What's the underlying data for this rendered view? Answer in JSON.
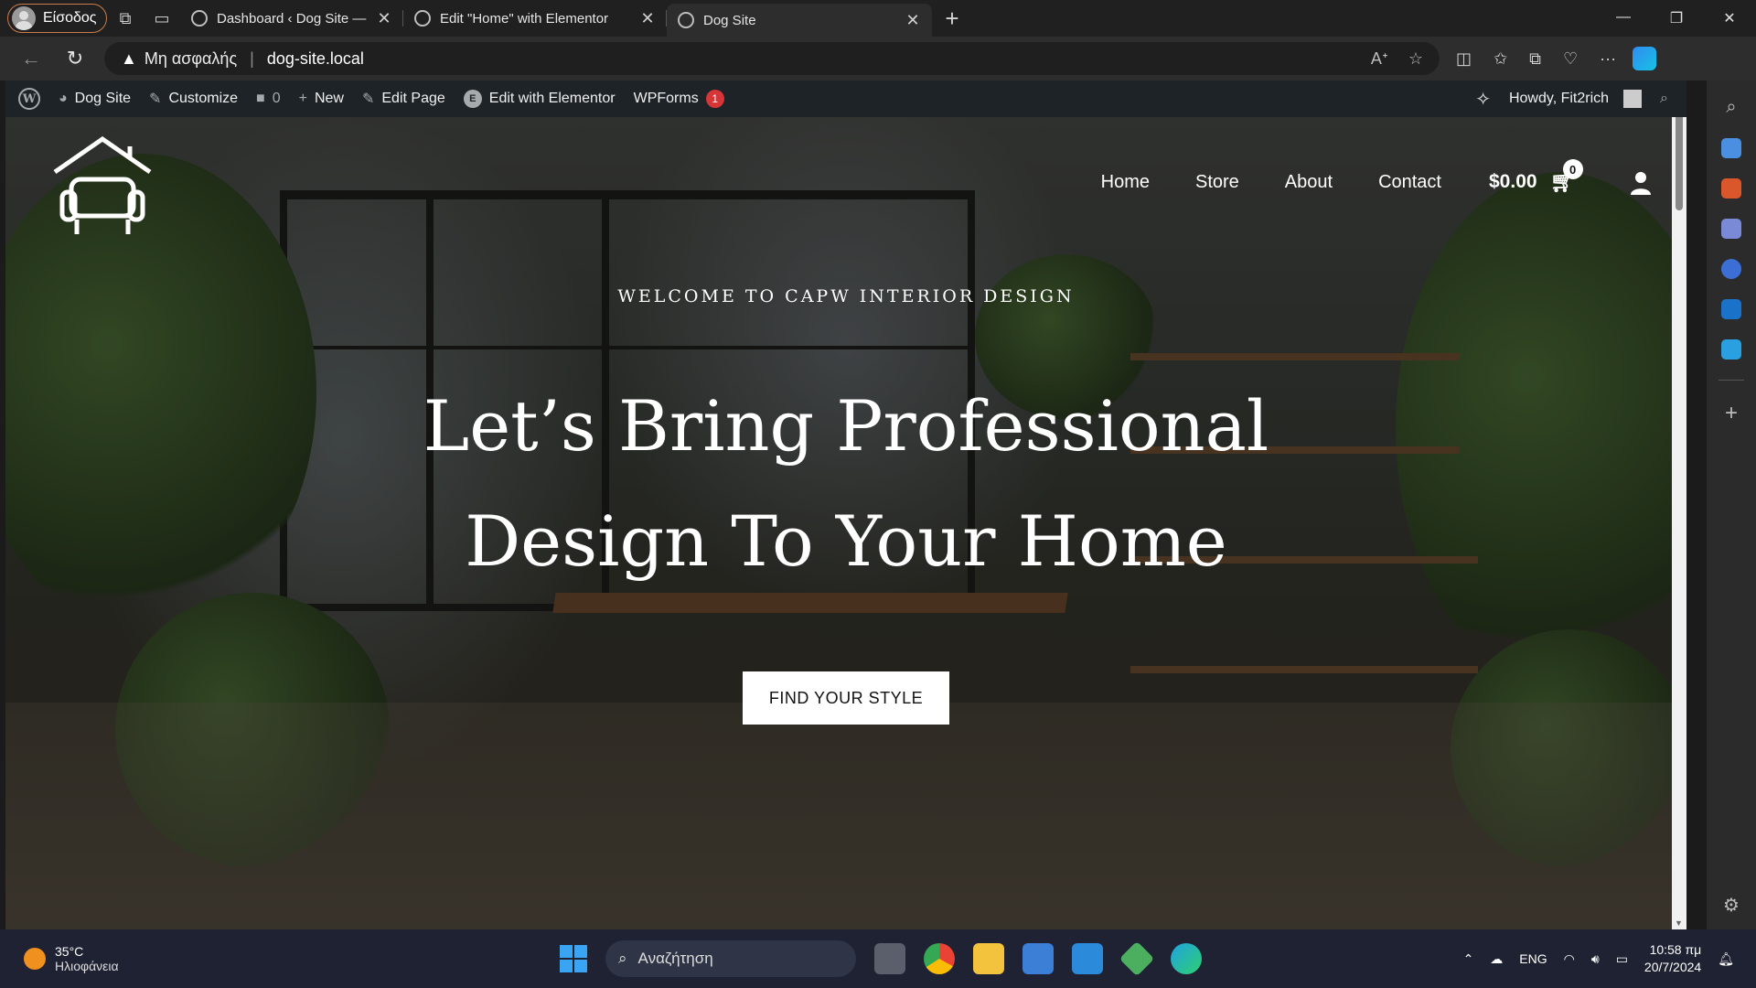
{
  "browser": {
    "profile_label": "Είσοδος",
    "tabs": [
      {
        "title": "Dashboard ‹ Dog Site — WordPress"
      },
      {
        "title": "Edit \"Home\" with Elementor"
      },
      {
        "title": "Dog Site"
      }
    ],
    "address": {
      "security_label": "Μη ασφαλής",
      "url": "dog-site.local"
    }
  },
  "wp_admin_bar": {
    "site_name": "Dog Site",
    "customize": "Customize",
    "comments_count": "0",
    "new": "New",
    "edit_page": "Edit Page",
    "edit_elementor": "Edit with Elementor",
    "wpforms": "WPForms",
    "wpforms_count": "1",
    "howdy": "Howdy, Fit2rich"
  },
  "site": {
    "nav": [
      "Home",
      "Store",
      "About",
      "Contact"
    ],
    "cart_total": "$0.00",
    "cart_count": "0",
    "kicker": "WELCOME TO CAPW INTERIOR DESIGN",
    "headline_line1": "Let’s Bring Professional",
    "headline_line2": "Design To Your Home",
    "cta": "FIND YOUR STYLE"
  },
  "taskbar": {
    "temperature": "35°C",
    "weather": "Ηλιοφάνεια",
    "search_placeholder": "Αναζήτηση",
    "language": "ENG",
    "time": "10:58 πμ",
    "date": "20/7/2024"
  },
  "colors": {
    "wp_admin_bar": "#1d2327",
    "badge_red": "#d63638",
    "taskbar": "#1e2233",
    "accent_blue": "#39a5f2"
  }
}
